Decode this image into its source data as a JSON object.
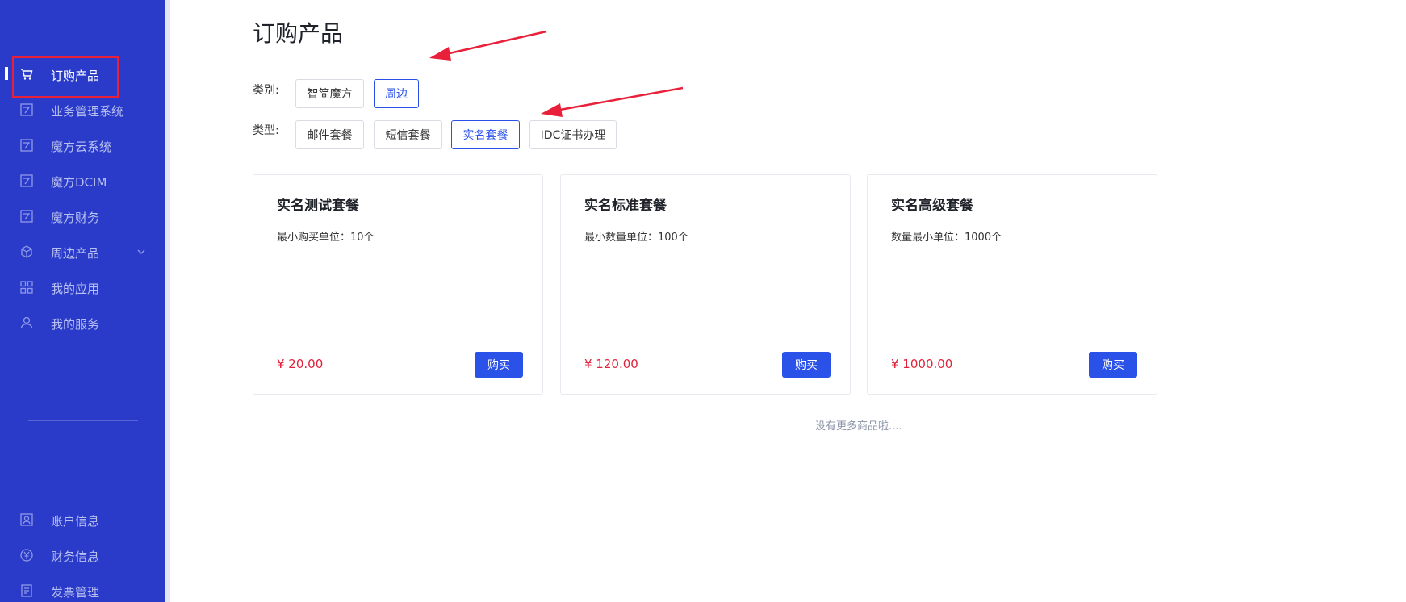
{
  "sidebar": {
    "items": [
      {
        "label": "订购产品",
        "icon": "cart-icon"
      },
      {
        "label": "业务管理系统",
        "icon": "app-logo-icon"
      },
      {
        "label": "魔方云系统",
        "icon": "app-logo-icon"
      },
      {
        "label": "魔方DCIM",
        "icon": "app-logo-icon"
      },
      {
        "label": "魔方财务",
        "icon": "app-logo-icon"
      },
      {
        "label": "周边产品",
        "icon": "cube-icon"
      },
      {
        "label": "我的应用",
        "icon": "grid-icon"
      },
      {
        "label": "我的服务",
        "icon": "user-icon"
      }
    ],
    "bottom_items": [
      {
        "label": "账户信息",
        "icon": "account-icon"
      },
      {
        "label": "财务信息",
        "icon": "yen-icon"
      },
      {
        "label": "发票管理",
        "icon": "invoice-icon"
      }
    ]
  },
  "main": {
    "title": "订购产品",
    "category": {
      "label": "类别:",
      "options": [
        "智简魔方",
        "周边"
      ],
      "selected": "周边"
    },
    "type": {
      "label": "类型:",
      "options": [
        "邮件套餐",
        "短信套餐",
        "实名套餐",
        "IDC证书办理"
      ],
      "selected": "实名套餐"
    },
    "products": [
      {
        "name": "实名测试套餐",
        "desc": "最小购买单位：10个",
        "price": "¥ 20.00",
        "buy_label": "购买"
      },
      {
        "name": "实名标准套餐",
        "desc": "最小数量单位：100个",
        "price": "¥ 120.00",
        "buy_label": "购买"
      },
      {
        "name": "实名高级套餐",
        "desc": "数量最小单位：1000个",
        "price": "¥ 1000.00",
        "buy_label": "购买"
      }
    ],
    "no_more": "没有更多商品啦...."
  },
  "colors": {
    "sidebar_bg": "#2b3bc9",
    "accent": "#2a52e8",
    "price": "#e0223a",
    "annotation": "#e8203a"
  }
}
